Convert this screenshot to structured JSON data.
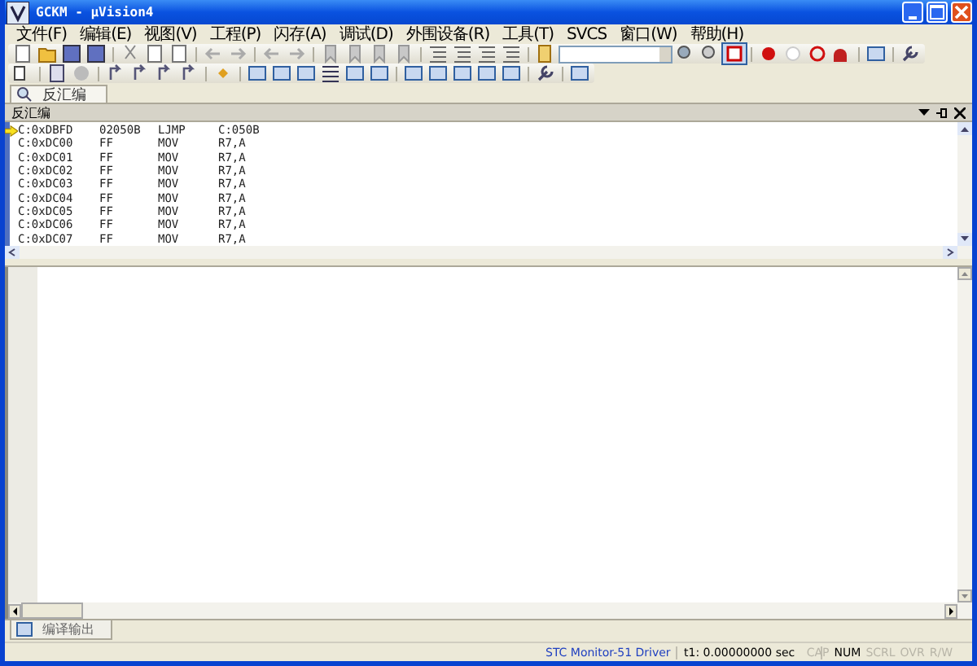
{
  "window": {
    "title": "GCKM - μVision4"
  },
  "menu": [
    "文件(F)",
    "编辑(E)",
    "视图(V)",
    "工程(P)",
    "闪存(A)",
    "调试(D)",
    "外围设备(R)",
    "工具(T)",
    "SVCS",
    "窗口(W)",
    "帮助(H)"
  ],
  "top_tab": {
    "label": "反汇编",
    "selected": true
  },
  "disassembly": {
    "title": "反汇编",
    "rows": [
      {
        "address": "C:0xDBFD",
        "bytes": "02050B",
        "mnemonic": "LJMP",
        "operand": "C:050B",
        "current": true
      },
      {
        "address": "C:0xDC00",
        "bytes": "FF",
        "mnemonic": "MOV",
        "operand": "R7,A",
        "current": false
      },
      {
        "address": "C:0xDC01",
        "bytes": "FF",
        "mnemonic": "MOV",
        "operand": "R7,A",
        "current": false
      },
      {
        "address": "C:0xDC02",
        "bytes": "FF",
        "mnemonic": "MOV",
        "operand": "R7,A",
        "current": false
      },
      {
        "address": "C:0xDC03",
        "bytes": "FF",
        "mnemonic": "MOV",
        "operand": "R7,A",
        "current": false
      },
      {
        "address": "C:0xDC04",
        "bytes": "FF",
        "mnemonic": "MOV",
        "operand": "R7,A",
        "current": false
      },
      {
        "address": "C:0xDC05",
        "bytes": "FF",
        "mnemonic": "MOV",
        "operand": "R7,A",
        "current": false
      },
      {
        "address": "C:0xDC06",
        "bytes": "FF",
        "mnemonic": "MOV",
        "operand": "R7,A",
        "current": false
      },
      {
        "address": "C:0xDC07",
        "bytes": "FF",
        "mnemonic": "MOV",
        "operand": "R7,A",
        "current": false
      }
    ]
  },
  "bottom_tab": {
    "label": "编译输出",
    "selected": true
  },
  "status_bar": {
    "driver": "STC Monitor-51 Driver",
    "time": "t1: 0.00000000 sec",
    "indicators": [
      {
        "label": "CAP",
        "on": false
      },
      {
        "label": "NUM",
        "on": true
      },
      {
        "label": "SCRL",
        "on": false
      },
      {
        "label": "OVR",
        "on": false
      },
      {
        "label": "R/W",
        "on": false
      }
    ]
  }
}
